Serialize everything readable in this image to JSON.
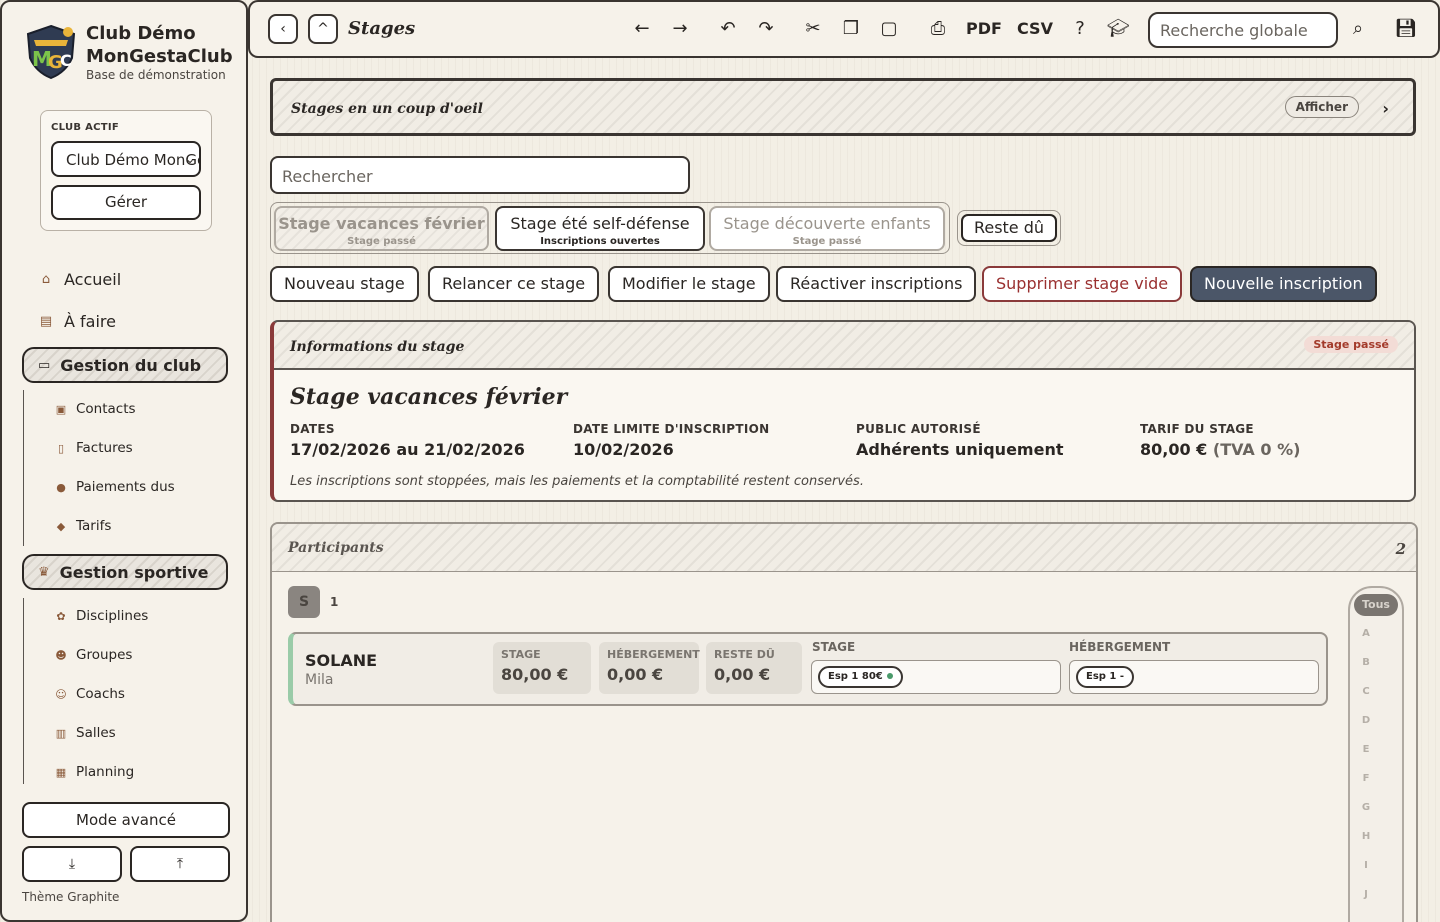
{
  "sidebar": {
    "brand_line1": "Club Démo",
    "brand_line2": "MonGestaClub",
    "brand_sub": "Base de démonstration",
    "club_label": "CLUB ACTIF",
    "club_value": "Club Démo MonGestaClub",
    "manage_label": "Gérer",
    "nav": [
      {
        "label": "Accueil",
        "icon": "home-icon"
      },
      {
        "label": "À faire",
        "icon": "clipboard-icon"
      }
    ],
    "groups": [
      {
        "label": "Gestion du club",
        "icon": "folder-icon",
        "items": [
          {
            "label": "Contacts",
            "icon": "contact-card-icon"
          },
          {
            "label": "Factures",
            "icon": "invoice-icon"
          },
          {
            "label": "Paiements dus",
            "icon": "payment-icon"
          },
          {
            "label": "Tarifs",
            "icon": "tag-icon"
          }
        ]
      },
      {
        "label": "Gestion sportive",
        "icon": "trophy-icon",
        "items": [
          {
            "label": "Disciplines",
            "icon": "palette-icon"
          },
          {
            "label": "Groupes",
            "icon": "group-icon"
          },
          {
            "label": "Coachs",
            "icon": "coach-icon"
          },
          {
            "label": "Salles",
            "icon": "building-icon"
          },
          {
            "label": "Planning",
            "icon": "calendar-icon"
          }
        ]
      }
    ],
    "advanced_label": "Mode avancé",
    "theme_label": "Thème Graphite"
  },
  "topbar": {
    "title": "Stages",
    "pdf_label": "PDF",
    "csv_label": "CSV",
    "search_placeholder": "Recherche globale"
  },
  "overview": {
    "title": "Stages en un coup d'oeil",
    "show_label": "Afficher"
  },
  "search": {
    "placeholder": "Rechercher"
  },
  "stage_tabs": [
    {
      "name": "Stage vacances février",
      "status": "Stage passé"
    },
    {
      "name": "Stage été self-défense",
      "status": "Inscriptions ouvertes"
    },
    {
      "name": "Stage découverte enfants",
      "status": "Stage passé"
    }
  ],
  "reste_du_label": "Reste dû",
  "actions": {
    "new_stage": "Nouveau stage",
    "remind": "Relancer ce stage",
    "edit": "Modifier le stage",
    "reactivate": "Réactiver inscriptions",
    "delete_empty": "Supprimer stage vide",
    "new_registration": "Nouvelle inscription"
  },
  "info": {
    "section_title": "Informations du stage",
    "status_badge": "Stage passé",
    "stage_name": "Stage vacances février",
    "dates_label": "DATES",
    "dates_value": "17/02/2026 au 21/02/2026",
    "deadline_label": "DATE LIMITE D'INSCRIPTION",
    "deadline_value": "10/02/2026",
    "public_label": "PUBLIC AUTORISÉ",
    "public_value": "Adhérents uniquement",
    "price_label": "TARIF DU STAGE",
    "price_value": "80,00 €",
    "price_tva": "(TVA 0 %)",
    "note": "Les inscriptions sont stoppées, mais les paiements et la comptabilité restent conservés."
  },
  "participants": {
    "title": "Participants",
    "count": "2",
    "letter_group": "S",
    "letter_count": "1",
    "rows": [
      {
        "last_name": "SOLANE",
        "first_name": "Mila",
        "stage_label": "STAGE",
        "stage_amount": "80,00 €",
        "hebergement_label": "HÉBERGEMENT",
        "hebergement_amount": "0,00 €",
        "reste_label": "RESTE DÛ",
        "reste_amount": "0,00 €",
        "stage_col_label": "STAGE",
        "stage_pill": "Esp 1 80€",
        "heb_col_label": "HÉBERGEMENT",
        "heb_pill": "Esp 1 -"
      }
    ],
    "alphabet": {
      "all_label": "Tous",
      "letters": [
        "A",
        "B",
        "C",
        "D",
        "E",
        "F",
        "G",
        "H",
        "I",
        "J"
      ]
    }
  },
  "colors": {
    "accent_dark": "#4b5668",
    "danger": "#9a3030",
    "status_badge_bg": "#f3dcd6",
    "participant_accent": "#9acba8"
  }
}
